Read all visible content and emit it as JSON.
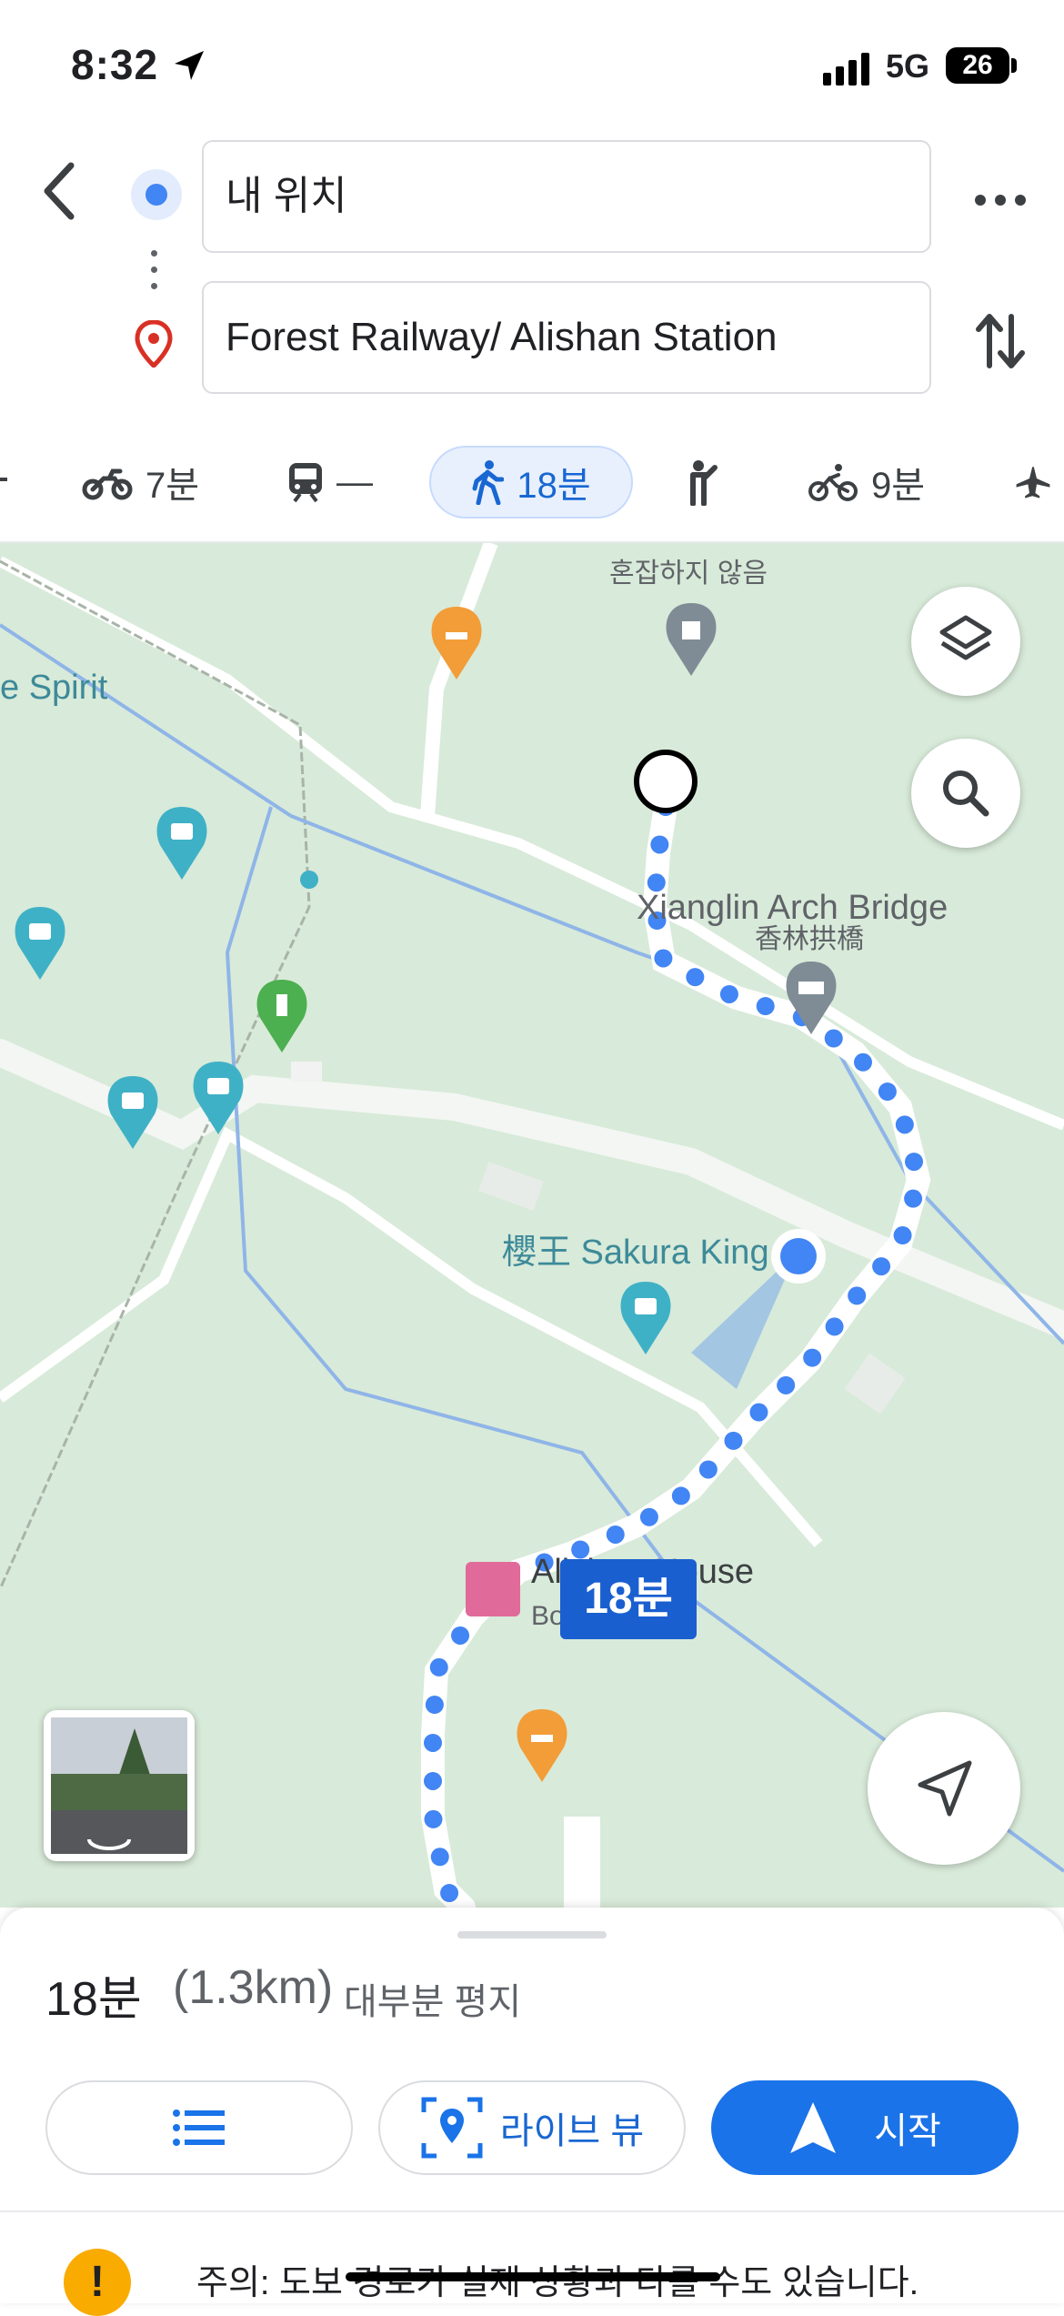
{
  "status_bar": {
    "time": "8:32",
    "network": "5G",
    "battery": "26"
  },
  "header": {
    "origin_value": "내 위치",
    "destination_value": "Forest Railway/ Alishan Station"
  },
  "modes": [
    {
      "name": "motorcycle",
      "label": "7분"
    },
    {
      "name": "transit",
      "label": "—"
    },
    {
      "name": "walk",
      "label": "18분",
      "selected": true
    },
    {
      "name": "ride",
      "label": ""
    },
    {
      "name": "bike",
      "label": "9분"
    },
    {
      "name": "flight",
      "label": ""
    }
  ],
  "map": {
    "labels": {
      "spirit": "e Spirit",
      "top_korean": "혼잡하지 않음",
      "bridge_en": "Xianglin Arch Bridge",
      "bridge_zh": "香林拱橋",
      "sakura": "櫻王 Sakura King",
      "house_en": "Alishan House",
      "house_sub": "Bo... - 호텔"
    },
    "eta_bubble": "18분",
    "route_color": "#4285f4"
  },
  "sheet": {
    "time": "18분",
    "distance": "(1.3km)",
    "terrain": "대부분 평지",
    "steps_label": "",
    "live_label": "라이브 뷰",
    "start_label": "시작",
    "warning": "주의: 도보 경로가 실제 상황과 다를 수도 있습니다."
  }
}
